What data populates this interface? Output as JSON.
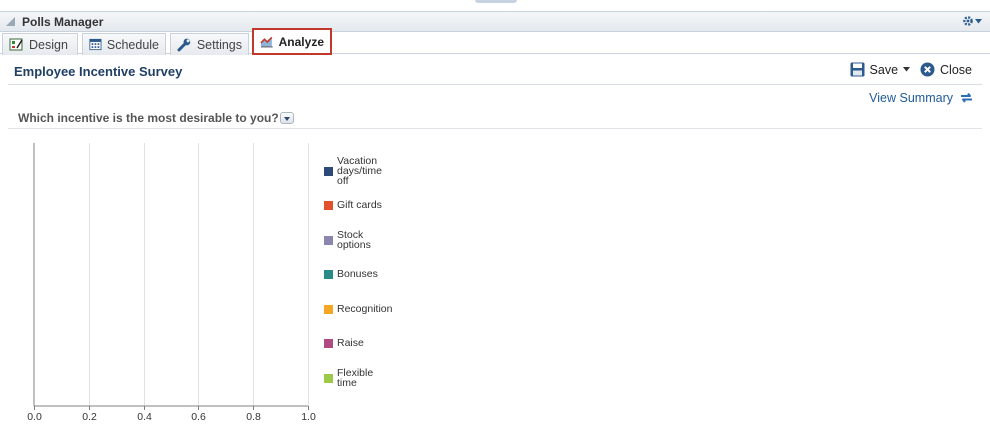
{
  "panel": {
    "title": "Polls Manager"
  },
  "tabs": [
    {
      "label": "Design",
      "icon": "design-icon"
    },
    {
      "label": "Schedule",
      "icon": "calendar-icon"
    },
    {
      "label": "Settings",
      "icon": "wrench-icon"
    },
    {
      "label": "Analyze",
      "icon": "analyze-chart-icon",
      "active": true
    }
  ],
  "survey": {
    "title": "Employee Incentive Survey"
  },
  "actions": {
    "save": "Save",
    "close": "Close"
  },
  "view_summary": "View Summary",
  "question": "Which incentive is the most desirable to you?",
  "colors": {
    "accent_red": "#c0392b",
    "link_blue": "#1f5a99",
    "title_blue": "#1f3f66"
  },
  "chart_data": {
    "type": "bar",
    "orientation": "horizontal",
    "xlim": [
      0,
      1.0
    ],
    "x_ticks": [
      "0.0",
      "0.2",
      "0.4",
      "0.6",
      "0.8",
      "1.0"
    ],
    "grid": true,
    "legend_position": "right",
    "series": [
      {
        "name": "Vacation\ndays/time\noff",
        "color": "#2b4a78",
        "value": 0
      },
      {
        "name": "Gift cards",
        "color": "#e0522b",
        "value": 0
      },
      {
        "name": "Stock\noptions",
        "color": "#8a86ad",
        "value": 0
      },
      {
        "name": "Bonuses",
        "color": "#2a8a86",
        "value": 0
      },
      {
        "name": "Recognition",
        "color": "#f5a623",
        "value": 0
      },
      {
        "name": "Raise",
        "color": "#b04a82",
        "value": 0
      },
      {
        "name": "Flexible\ntime",
        "color": "#9cc94a",
        "value": 0
      }
    ]
  }
}
